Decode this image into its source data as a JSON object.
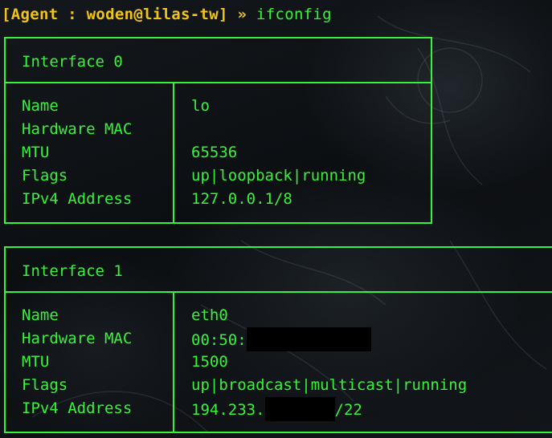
{
  "terminal": {
    "prompt_open": "[",
    "prompt_agent": "Agent : woden@lilas-tw",
    "prompt_close": "]",
    "prompt_arrow": " » ",
    "command": "ifconfig"
  },
  "interfaces": [
    {
      "title": "Interface 0",
      "rows": [
        {
          "key": "Name",
          "value": "lo"
        },
        {
          "key": "Hardware MAC",
          "value": ""
        },
        {
          "key": "MTU",
          "value": "65536"
        },
        {
          "key": "Flags",
          "value": "up|loopback|running"
        },
        {
          "key": "IPv4 Address",
          "value": "127.0.0.1/8"
        }
      ]
    },
    {
      "title": "Interface 1",
      "rows": [
        {
          "key": "Name",
          "value": "eth0"
        },
        {
          "key": "Hardware MAC",
          "value": "00:50:"
        },
        {
          "key": "MTU",
          "value": "1500"
        },
        {
          "key": "Flags",
          "value": "up|broadcast|multicast|running"
        },
        {
          "key": "IPv4 Address",
          "value": "194.233.",
          "suffix": "/22"
        }
      ]
    }
  ],
  "colors": {
    "text": "#37f23a",
    "prompt_host": "#f0c41a",
    "background": "#0b0d0f",
    "redaction": "#000000"
  }
}
